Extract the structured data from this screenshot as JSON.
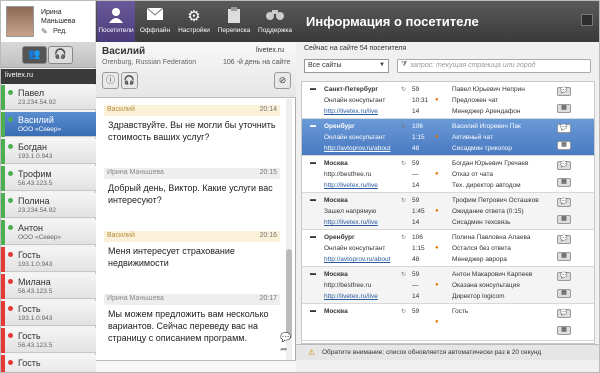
{
  "profile": {
    "name_line1": "Ирина",
    "name_line2": "Маньшева",
    "edit_label": "Ред."
  },
  "toolbar": [
    {
      "label": "Посетители",
      "icon": "visitors-icon"
    },
    {
      "label": "Оффлайн",
      "icon": "envelope-icon"
    },
    {
      "label": "Настройки",
      "icon": "gear-icon"
    },
    {
      "label": "Переписка",
      "icon": "clipboard-icon"
    },
    {
      "label": "Поддержка",
      "icon": "binoculars-icon"
    }
  ],
  "panel_title": "Информация о посетителе",
  "left": {
    "site": "livetex.ru",
    "visitors": [
      {
        "name": "Павел",
        "sub": "23.234.54.92",
        "status": "#4caf50"
      },
      {
        "name": "Василий",
        "sub": "ООО «Север»",
        "status": "#4caf50",
        "selected": true
      },
      {
        "name": "Богдан",
        "sub": "193.1.0.943",
        "status": "#4caf50"
      },
      {
        "name": "Трофим",
        "sub": "56.43.123.5",
        "status": "#4caf50"
      },
      {
        "name": "Полина",
        "sub": "23.234.54.92",
        "status": "#4caf50"
      },
      {
        "name": "Антон",
        "sub": "ООО «Север»",
        "status": "#4caf50"
      },
      {
        "name": "Гость",
        "sub": "193.1.0.943",
        "status": "#e53935"
      },
      {
        "name": "Милана",
        "sub": "56.43.123.5",
        "status": "#e53935"
      },
      {
        "name": "Гость",
        "sub": "193.1.0.943",
        "status": "#e53935"
      },
      {
        "name": "Гость",
        "sub": "56.43.123.5",
        "status": "#e53935"
      },
      {
        "name": "Гость",
        "sub": "",
        "status": "#e53935"
      }
    ]
  },
  "chat": {
    "visitor_name": "Василий",
    "location": "Orenburg, Russian Federation",
    "site": "livetex.ru",
    "ip": "106 -й день на сайте",
    "messages": [
      {
        "type": "vis-m",
        "author": "Василий",
        "time": "20:14",
        "text": "Здравствуйте. Вы не могли бы уточнить стоимость ваших услуг?"
      },
      {
        "type": "op-m",
        "author": "Ирина Маньшева",
        "time": "20:15",
        "text": "Добрый день, Виктор. Какие услуги вас интересуют?"
      },
      {
        "type": "vis-m",
        "author": "Василий",
        "time": "20:16",
        "text": "Меня интересует страхование недвижимости"
      },
      {
        "type": "op-m",
        "author": "Ирина Маньшева",
        "time": "20:17",
        "text": "Мы можем предложить вам несколько вариантов. Сейчас переведу вас на страницу с описанием программ."
      }
    ]
  },
  "right": {
    "count": "Сейчас на сайте 54 посетителя",
    "select": "Все сайты",
    "search_placeholder": "запрос: текущая страница или город",
    "warning": "Обратите внимание: список обновляется автоматически раз в 20 секунд",
    "rows": [
      {
        "city": "Санкт-Петербург",
        "src": "Онлайн консультант",
        "url": "http://livetex.ru/live",
        "n1": "59",
        "n2": "10:31",
        "n3": "14",
        "v1": "Павел Юрьевич Неприн",
        "v2": "Предложен чат",
        "v3": "Менеджер Арендафон"
      },
      {
        "city": "Оренбург",
        "src": "Онлайн консультант",
        "url": "http://avtoprov.ru/about",
        "n1": "106",
        "n2": "1:15",
        "n3": "48",
        "v1": "Василий Игоревич Пак",
        "v2": "Активный чат",
        "v3": "Сисадмин трикопор",
        "hl": true
      },
      {
        "city": "Москва",
        "src": "http://bestfree.ru",
        "url": "http://livetex.ru/live",
        "n1": "59",
        "n2": "—",
        "n3": "14",
        "v1": "Богдан Юрьевич Гречаев",
        "v2": "Отказ от чата",
        "v3": "Тех. директор автодом"
      },
      {
        "city": "Москва",
        "src": "Зашел напрямую",
        "url": "http://livetex.ru/live",
        "n1": "59",
        "n2": "1:45",
        "n3": "14",
        "v1": "Трофим Петрович Осташков",
        "v2": "Ожидание ответа (0:15)",
        "v3": "Сисадмин техсвязь"
      },
      {
        "city": "Оренбург",
        "src": "Онлайн консультант",
        "url": "http://avtoprov.ru/about",
        "n1": "106",
        "n2": "1:15",
        "n3": "48",
        "v1": "Полина Павловна Алаева",
        "v2": "Остался без ответа",
        "v3": "Менеджер аврора"
      },
      {
        "city": "Москва",
        "src": "http://bestfree.ru",
        "url": "http://livetex.ru/live",
        "n1": "59",
        "n2": "—",
        "n3": "14",
        "v1": "Антон Макарович Карпеев",
        "v2": "Оказана консультация",
        "v3": "Директор logicom"
      },
      {
        "city": "Москва",
        "src": "",
        "url": "",
        "n1": "59",
        "n2": "",
        "n3": "",
        "v1": "Гость",
        "v2": "",
        "v3": ""
      }
    ]
  }
}
